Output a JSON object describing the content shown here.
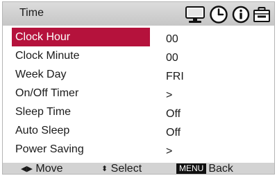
{
  "header": {
    "title": "Time",
    "tabs": [
      {
        "icon": "monitor-icon",
        "active": false
      },
      {
        "icon": "clock-icon",
        "active": true
      },
      {
        "icon": "info-icon",
        "active": false
      },
      {
        "icon": "toolbox-icon",
        "active": false
      }
    ]
  },
  "menu": {
    "items": [
      {
        "label": "Clock Hour",
        "value": "00"
      },
      {
        "label": "Clock Minute",
        "value": "00"
      },
      {
        "label": "Week Day",
        "value": "FRI"
      },
      {
        "label": "On/Off Timer",
        "value": ">"
      },
      {
        "label": "Sleep Time",
        "value": "Off"
      },
      {
        "label": "Auto Sleep",
        "value": "Off"
      },
      {
        "label": "Power Saving",
        "value": ">"
      }
    ],
    "selected_label": "Clock Hour"
  },
  "footer": {
    "move_arrows": "◀▶",
    "move_label": "Move",
    "select_arrows": "⬍",
    "select_label": "Select",
    "menu_key": "MENU",
    "back_label": "Back"
  },
  "colors": {
    "selection": "#b5123c",
    "header_bg": "#d0d0d0",
    "footer_bg": "#d3d3d3"
  }
}
